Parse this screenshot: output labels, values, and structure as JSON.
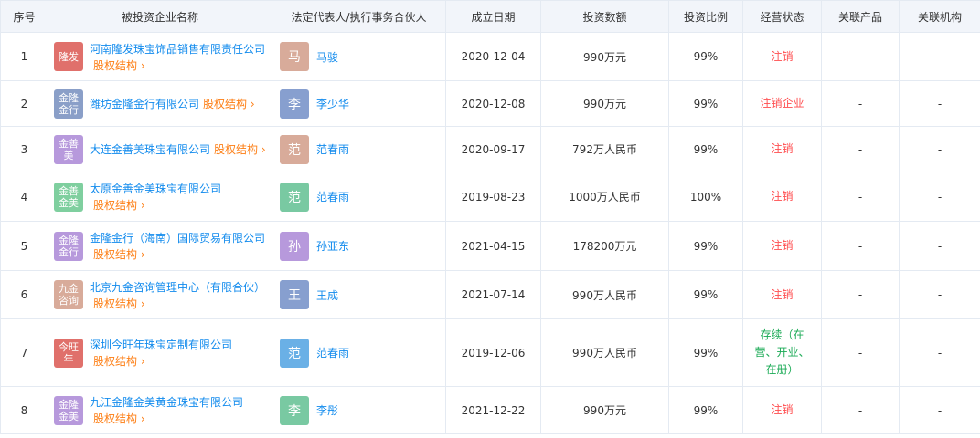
{
  "headers": [
    "序号",
    "被投资企业名称",
    "法定代表人/执行事务合伙人",
    "成立日期",
    "投资数额",
    "投资比例",
    "经营状态",
    "关联产品",
    "关联机构"
  ],
  "equity_label": "股权结构",
  "rows": [
    {
      "index": "1",
      "logo": "隆发",
      "logo_color": "#e0706b",
      "company": "河南隆发珠宝饰品销售有限责任公司",
      "avatar": "马",
      "avatar_color": "#d8ab9a",
      "person": "马骏",
      "date": "2020-12-04",
      "amount": "990万元",
      "ratio": "99%",
      "status": "注销",
      "status_color": "#ff4d4f",
      "product": "-",
      "org": "-"
    },
    {
      "index": "2",
      "logo": "金隆金行",
      "logo_color": "#8a9fc8",
      "company": "潍坊金隆金行有限公司",
      "avatar": "李",
      "avatar_color": "#879fcf",
      "person": "李少华",
      "date": "2020-12-08",
      "amount": "990万元",
      "ratio": "99%",
      "status": "注销企业",
      "status_color": "#ff4d4f",
      "product": "-",
      "org": "-"
    },
    {
      "index": "3",
      "logo": "金善美",
      "logo_color": "#b799dc",
      "company": "大连金善美珠宝有限公司",
      "avatar": "范",
      "avatar_color": "#d8ab9a",
      "person": "范春雨",
      "date": "2020-09-17",
      "amount": "792万人民币",
      "ratio": "99%",
      "status": "注销",
      "status_color": "#ff4d4f",
      "product": "-",
      "org": "-"
    },
    {
      "index": "4",
      "logo": "金善金美",
      "logo_color": "#7fcf9f",
      "company": "太原金善金美珠宝有限公司",
      "avatar": "范",
      "avatar_color": "#79c9a2",
      "person": "范春雨",
      "date": "2019-08-23",
      "amount": "1000万人民币",
      "ratio": "100%",
      "status": "注销",
      "status_color": "#ff4d4f",
      "product": "-",
      "org": "-"
    },
    {
      "index": "5",
      "logo": "金隆金行",
      "logo_color": "#b799dc",
      "company": "金隆金行（海南）国际贸易有限公司",
      "avatar": "孙",
      "avatar_color": "#b799dc",
      "person": "孙亚东",
      "date": "2021-04-15",
      "amount": "178200万元",
      "ratio": "99%",
      "status": "注销",
      "status_color": "#ff4d4f",
      "product": "-",
      "org": "-"
    },
    {
      "index": "6",
      "logo": "九金咨询",
      "logo_color": "#d8ab9a",
      "company": "北京九金咨询管理中心（有限合伙）",
      "avatar": "王",
      "avatar_color": "#879fcf",
      "person": "王成",
      "date": "2021-07-14",
      "amount": "990万人民币",
      "ratio": "99%",
      "status": "注销",
      "status_color": "#ff4d4f",
      "product": "-",
      "org": "-"
    },
    {
      "index": "7",
      "logo": "今旺年",
      "logo_color": "#e0706b",
      "company": "深圳今旺年珠宝定制有限公司",
      "avatar": "范",
      "avatar_color": "#6ab0e6",
      "person": "范春雨",
      "date": "2019-12-06",
      "amount": "990万人民币",
      "ratio": "99%",
      "status": "存续（在营、开业、在册）",
      "status_color": "#1aaa55",
      "product": "-",
      "org": "-"
    },
    {
      "index": "8",
      "logo": "金隆金美",
      "logo_color": "#b799dc",
      "company": "九江金隆金美黄金珠宝有限公司",
      "avatar": "李",
      "avatar_color": "#79c9a2",
      "person": "李彤",
      "date": "2021-12-22",
      "amount": "990万元",
      "ratio": "99%",
      "status": "注销",
      "status_color": "#ff4d4f",
      "product": "-",
      "org": "-"
    }
  ]
}
